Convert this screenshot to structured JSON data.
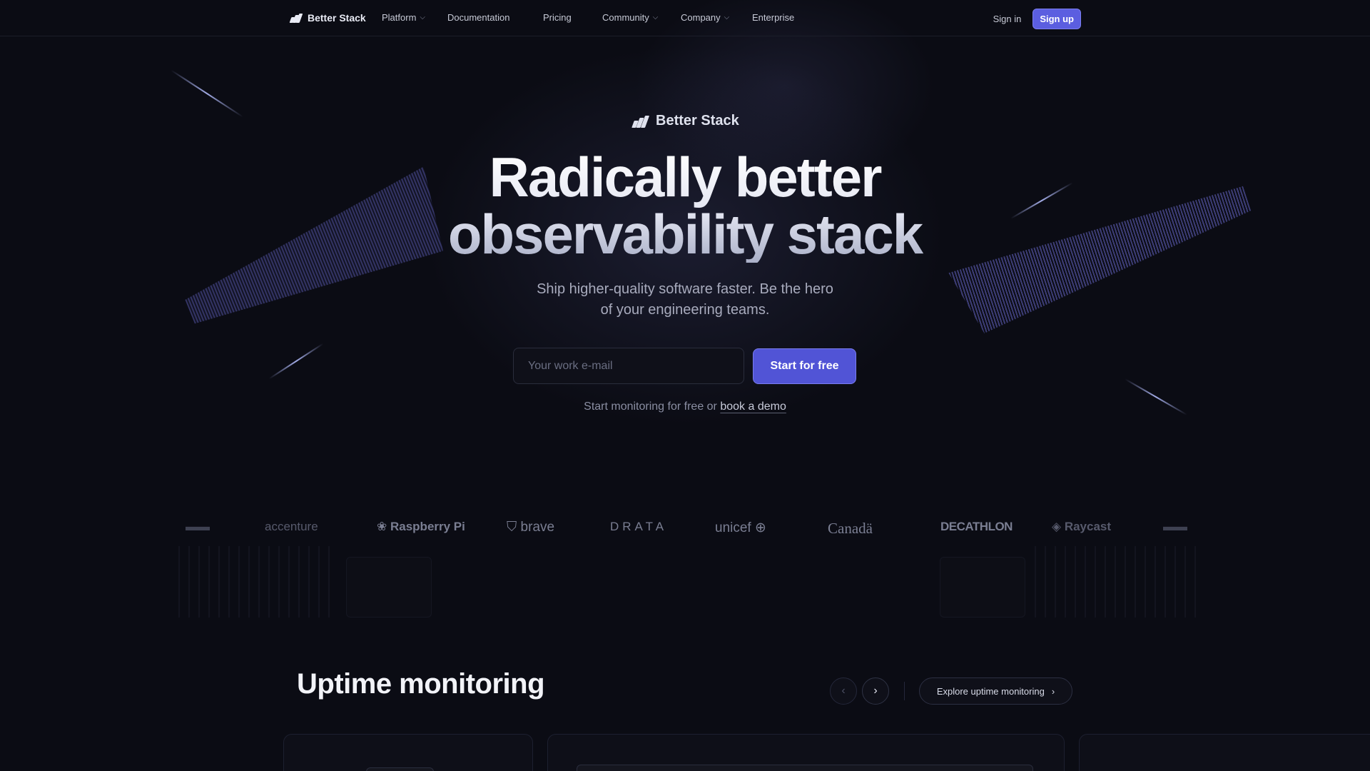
{
  "nav": {
    "brand": "Better Stack",
    "links": [
      {
        "label": "Platform",
        "has_dropdown": true
      },
      {
        "label": "Documentation",
        "has_dropdown": false
      },
      {
        "label": "Pricing",
        "has_dropdown": false
      },
      {
        "label": "Community",
        "has_dropdown": true
      },
      {
        "label": "Company",
        "has_dropdown": true
      },
      {
        "label": "Enterprise",
        "has_dropdown": false
      }
    ],
    "sign_in": "Sign in",
    "sign_up": "Sign up"
  },
  "hero": {
    "brand": "Better Stack",
    "headline_line1": "Radically better",
    "headline_line2": "observability stack",
    "sub_line1": "Ship higher-quality software faster. Be the hero",
    "sub_line2": "of your engineering teams.",
    "email_placeholder": "Your work e-mail",
    "cta": "Start for free",
    "demo_prefix": "Start monitoring for free or",
    "demo_link": "book a demo"
  },
  "customer_logos": [
    "accenture",
    "Raspberry Pi",
    "brave",
    "DRATA",
    "unicef",
    "Canadä",
    "DECATHLON",
    "Raycast"
  ],
  "section": {
    "title": "Uptime monitoring",
    "explore": "Explore uptime monitoring"
  },
  "colors": {
    "background": "#0b0c14",
    "accent": "#5154d6",
    "accent_border": "#7a7dee",
    "text_muted": "#a8abbd"
  },
  "icons": {
    "brand_logo": "better-stack-logo-icon",
    "dropdown": "chevron-down-icon",
    "prev": "chevron-left-icon",
    "next": "chevron-right-icon"
  }
}
